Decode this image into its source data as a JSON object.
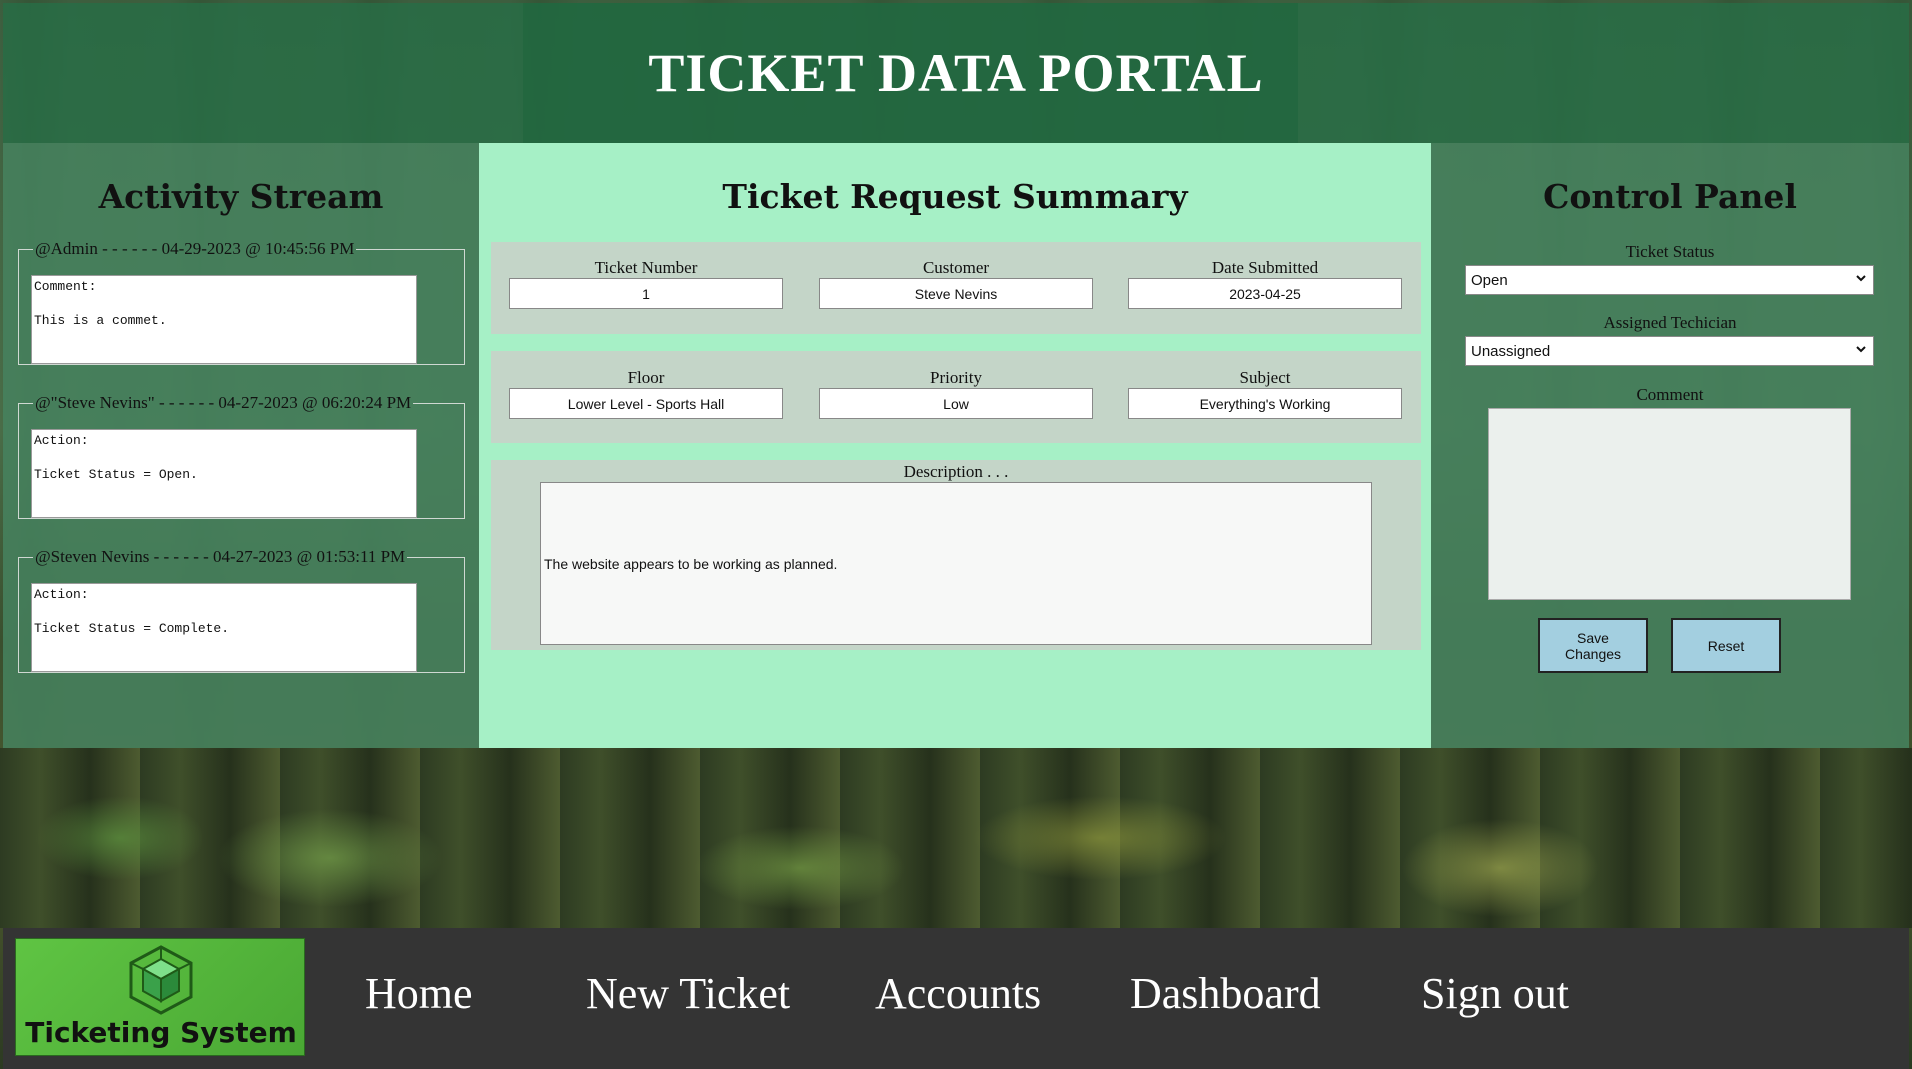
{
  "header": {
    "title": "TICKET DATA PORTAL"
  },
  "activity": {
    "title": "Activity Stream",
    "items": [
      {
        "legend": "@Admin - - - - - - 04-29-2023 @ 10:45:56 PM",
        "body": "Comment:\n\nThis is a commet."
      },
      {
        "legend": "@\"Steve Nevins\" - - - - - - 04-27-2023 @ 06:20:24 PM",
        "body": "Action:\n\nTicket Status = Open."
      },
      {
        "legend": "@Steven Nevins - - - - - - 04-27-2023 @ 01:53:11 PM",
        "body": "Action:\n\nTicket Status = Complete."
      }
    ]
  },
  "summary": {
    "title": "Ticket Request Summary",
    "ticket_number": {
      "label": "Ticket Number",
      "value": "1"
    },
    "customer": {
      "label": "Customer",
      "value": "Steve Nevins"
    },
    "date_submitted": {
      "label": "Date Submitted",
      "value": "2023-04-25"
    },
    "floor": {
      "label": "Floor",
      "value": "Lower Level - Sports Hall"
    },
    "priority": {
      "label": "Priority",
      "value": "Low"
    },
    "subject": {
      "label": "Subject",
      "value": "Everything's Working"
    },
    "description": {
      "label": "Description . . .",
      "value": "The website appears to be working as planned."
    }
  },
  "control": {
    "title": "Control Panel",
    "status_label": "Ticket Status",
    "status_value": "Open",
    "tech_label": "Assigned Techician",
    "tech_value": "Unassigned",
    "comment_label": "Comment",
    "save_label": "Save\nChanges",
    "reset_label": "Reset"
  },
  "nav": {
    "logo_text": "Ticketing System",
    "links": [
      "Home",
      "New Ticket",
      "Accounts",
      "Dashboard",
      "Sign out"
    ]
  },
  "colors": {
    "header_bg": "#266e46",
    "summary_bg": "#a6f0c6",
    "button_bg": "#a3cfe0",
    "navbar_bg": "#343434",
    "logo_green": "#5fc443"
  }
}
